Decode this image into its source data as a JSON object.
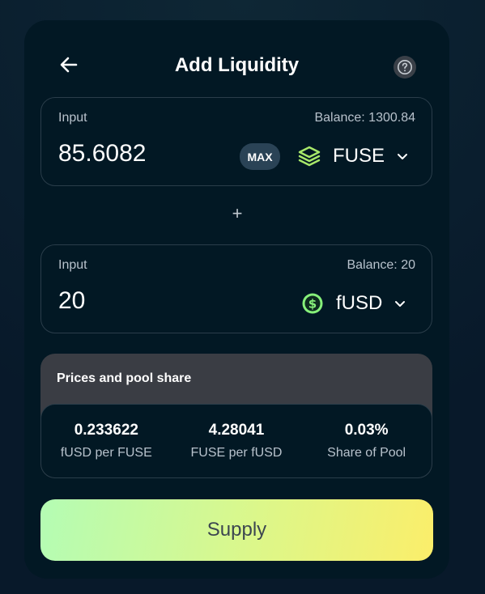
{
  "header": {
    "title": "Add Liquidity",
    "back_icon": "arrow-left-icon",
    "help_icon": "question-circle-icon"
  },
  "input_a": {
    "label": "Input",
    "balance": "Balance: 1300.84",
    "amount": "85.6082",
    "max_label": "MAX",
    "token": "FUSE",
    "token_icon": "fuse-stack-icon"
  },
  "separator": "+",
  "input_b": {
    "label": "Input",
    "balance": "Balance: 20",
    "amount": "20",
    "token": "fUSD",
    "token_icon": "fusd-dollar-icon"
  },
  "prices": {
    "title": "Prices and pool share",
    "stats": [
      {
        "value": "0.233622",
        "label": "fUSD per FUSE"
      },
      {
        "value": "4.28041",
        "label": "FUSE per fUSD"
      },
      {
        "value": "0.03%",
        "label": "Share of Pool"
      }
    ]
  },
  "actions": {
    "supply_label": "Supply"
  },
  "colors": {
    "card_bg": "#021824",
    "accent_start": "#b4fcb4",
    "accent_end": "#fbee6a",
    "fuse_icon": "#a8e86a",
    "fusd_icon": "#86f07a"
  }
}
